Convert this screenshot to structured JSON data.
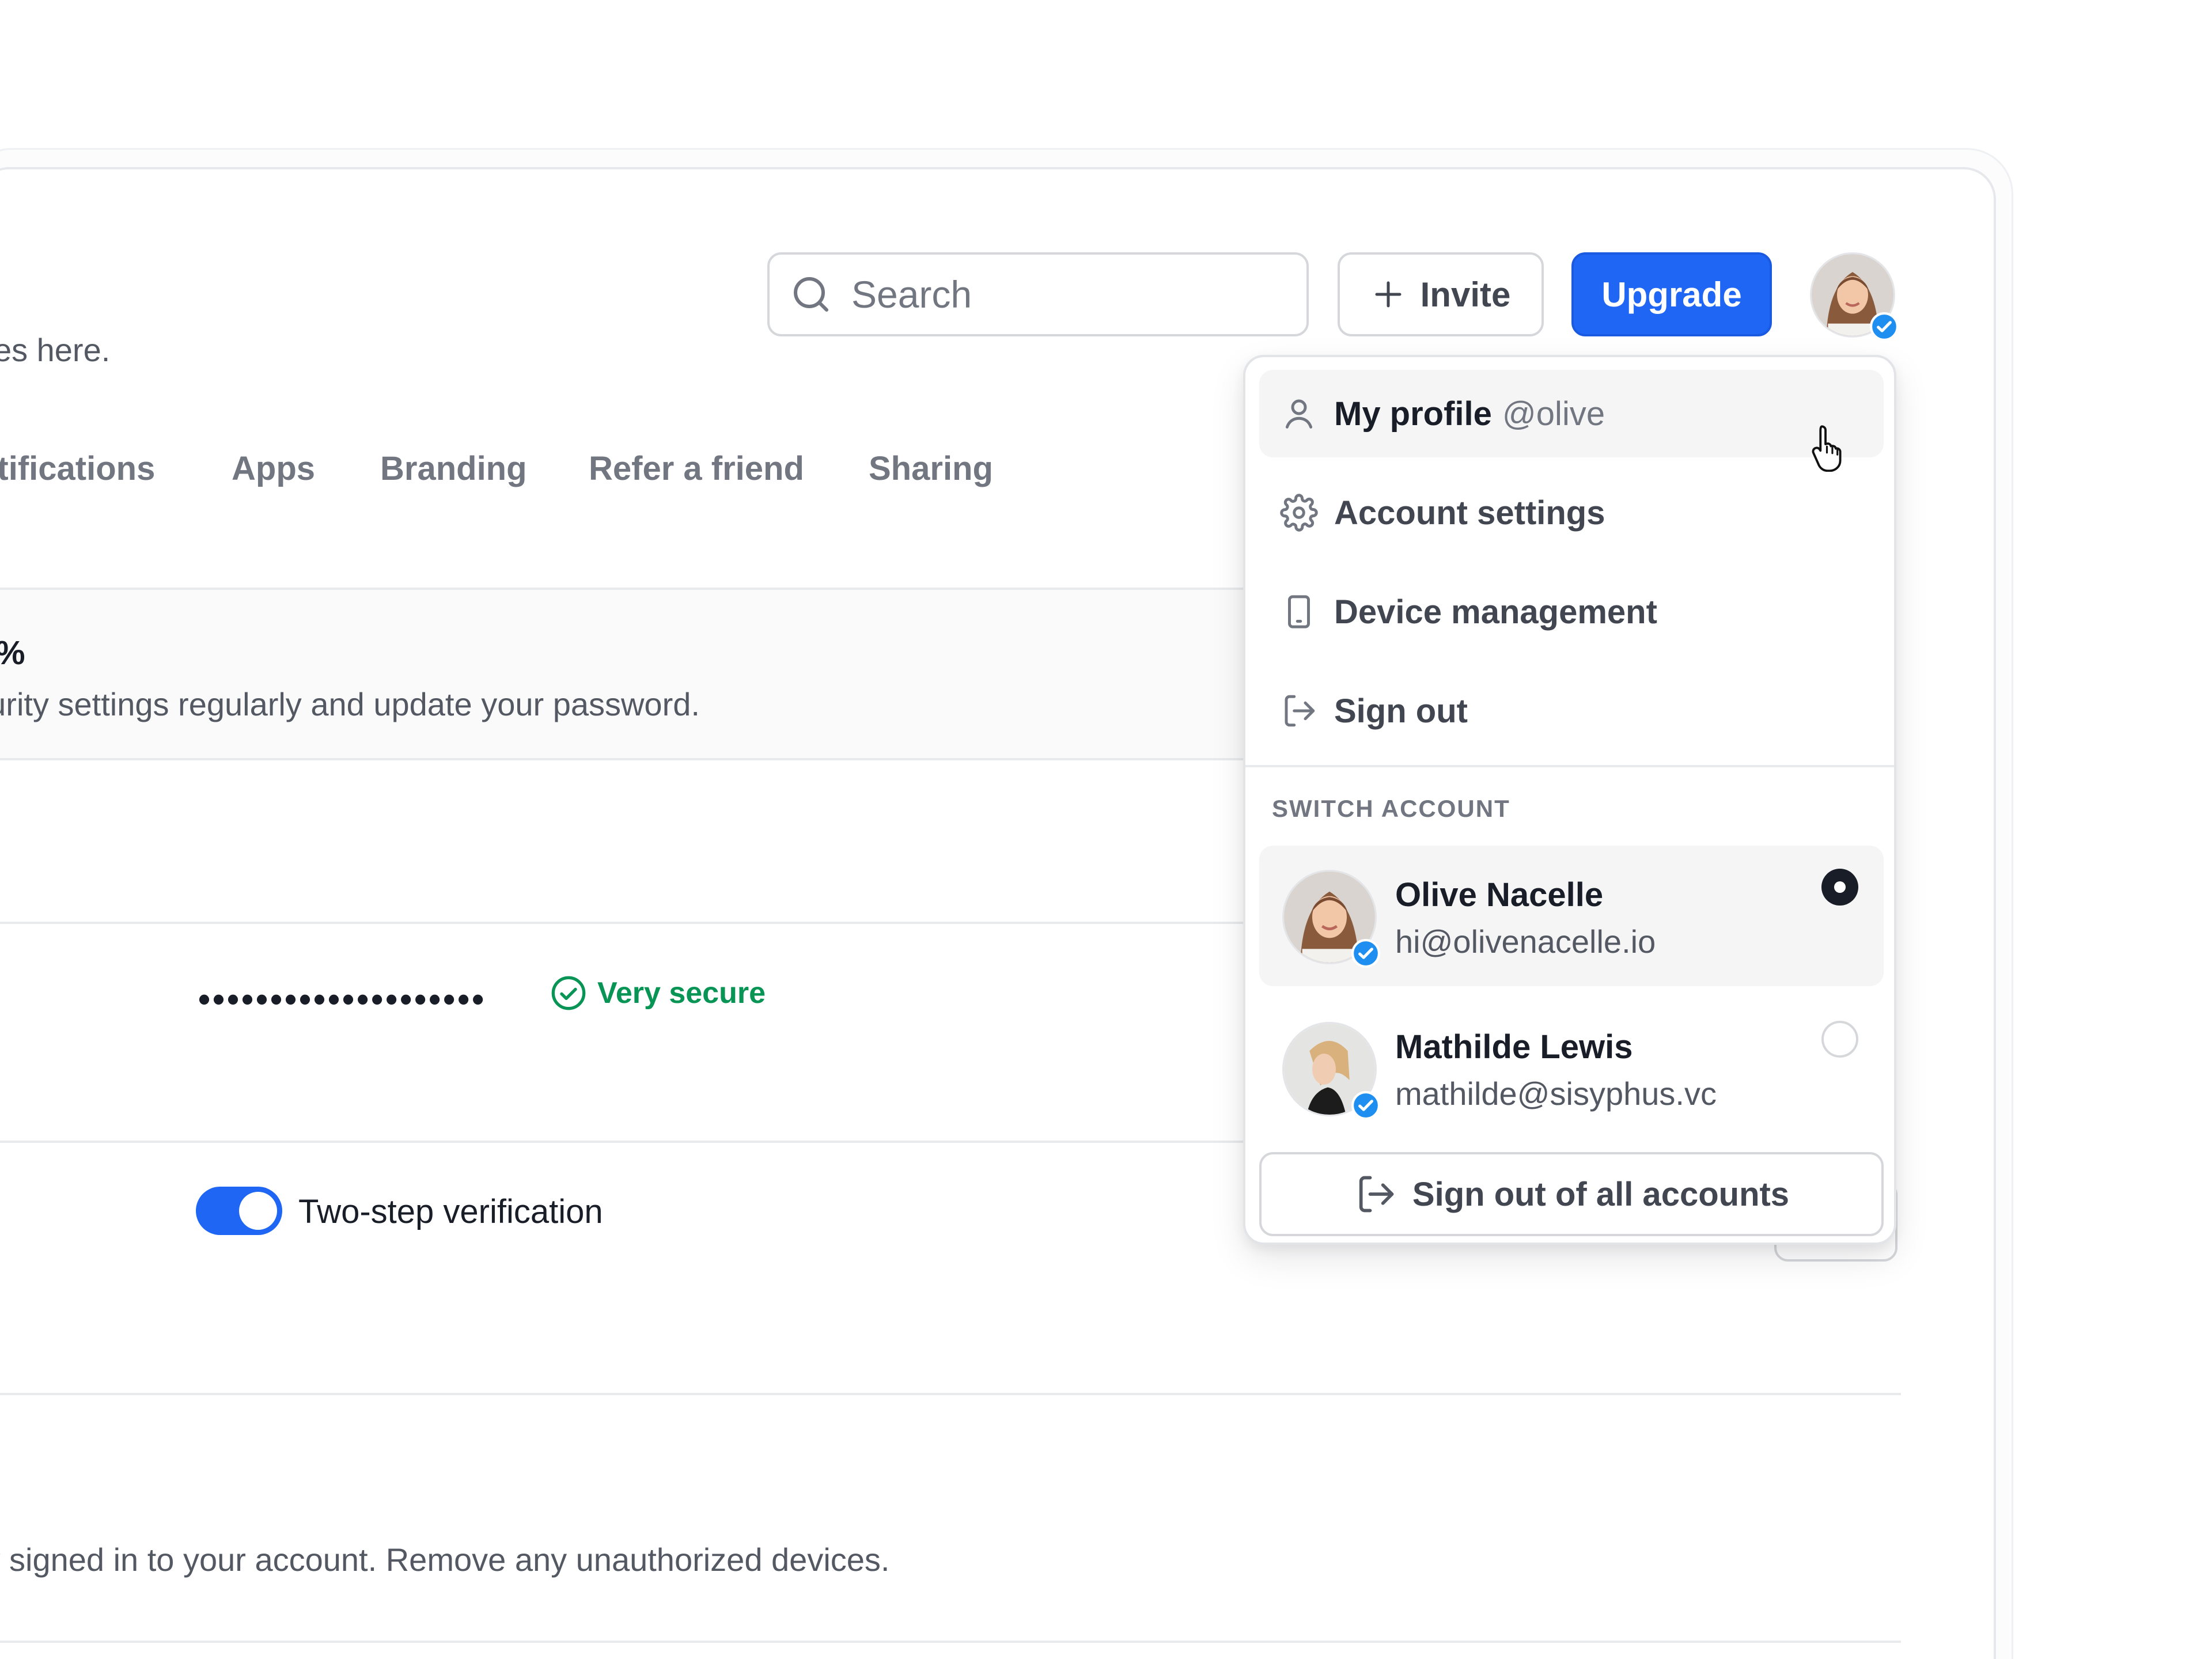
{
  "header": {
    "subtitle": "rences here.",
    "search_placeholder": "Search",
    "invite_label": "Invite",
    "upgrade_label": "Upgrade"
  },
  "tabs": [
    "otifications",
    "Apps",
    "Branding",
    "Refer a friend",
    "Sharing"
  ],
  "security": {
    "percent_fragment": "%",
    "banner_text": "ecurity settings regularly and update your password.",
    "password_mask": "••••••••••••••••••••",
    "password_status": "Very secure",
    "two_step_label": "Two-step verification",
    "two_step_enabled": true,
    "devices_text": "ly signed in to your account. Remove any unauthorized devices."
  },
  "dropdown": {
    "items": [
      {
        "label": "My profile",
        "handle": "@olive",
        "icon": "user-icon"
      },
      {
        "label": "Account settings",
        "icon": "gear-icon"
      },
      {
        "label": "Device management",
        "icon": "phone-icon"
      },
      {
        "label": "Sign out",
        "icon": "log-out-icon"
      }
    ],
    "switch_account_label": "SWITCH ACCOUNT",
    "accounts": [
      {
        "name": "Olive Nacelle",
        "email": "hi@olivenacelle.io",
        "selected": true
      },
      {
        "name": "Mathilde Lewis",
        "email": "mathilde@sisyphus.vc",
        "selected": false
      }
    ],
    "sign_out_all_label": "Sign out of all accounts"
  },
  "colors": {
    "primary": "#1f66f5",
    "success": "#079455",
    "verified_badge": "#1f8ef1"
  }
}
